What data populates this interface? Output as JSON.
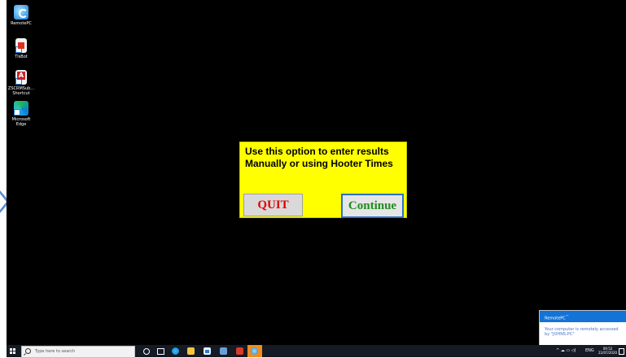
{
  "desktop": {
    "icons": [
      {
        "label": "RemotePC",
        "icon": "remotepc-icon"
      },
      {
        "label": "TlsBot",
        "icon": "document-icon"
      },
      {
        "label": "ZSCRMSub... Shortcut",
        "icon": "access-database-icon"
      },
      {
        "label": "Microsoft Edge",
        "icon": "edge-icon"
      }
    ]
  },
  "dialog": {
    "message_line1": "Use this option to enter results",
    "message_line2": "Manually or using Hooter Times",
    "quit_label": "QUIT",
    "continue_label": "Continue",
    "colors": {
      "background": "#ffff00",
      "quit_text": "#e00000",
      "continue_text": "#1e8c1e"
    }
  },
  "notification": {
    "title": "RemotePC",
    "title_mark": "™",
    "message": "Your computer is remotely accessed by \"JOHNS-PC\""
  },
  "taskbar": {
    "search_placeholder": "Type here to search",
    "tray_glyphs": "^ ☁ ▭ ◁)",
    "language": "ENG",
    "time": "09:52",
    "date": "22/07/2020"
  }
}
